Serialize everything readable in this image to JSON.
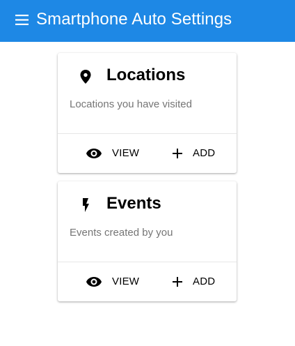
{
  "app": {
    "title": "Smartphone Auto Settings",
    "color": "#1e88e5",
    "menu_icon": "menu-icon"
  },
  "cards": [
    {
      "title": "Locations",
      "subtitle": "Locations you have visited",
      "icon": "location-pin-icon",
      "actions": [
        {
          "label": "VIEW",
          "icon": "eye-icon"
        },
        {
          "label": "ADD",
          "icon": "plus-icon"
        }
      ]
    },
    {
      "title": "Events",
      "subtitle": "Events created by you",
      "icon": "lightning-bolt-icon",
      "actions": [
        {
          "label": "VIEW",
          "icon": "eye-icon"
        },
        {
          "label": "ADD",
          "icon": "plus-icon"
        }
      ]
    }
  ]
}
